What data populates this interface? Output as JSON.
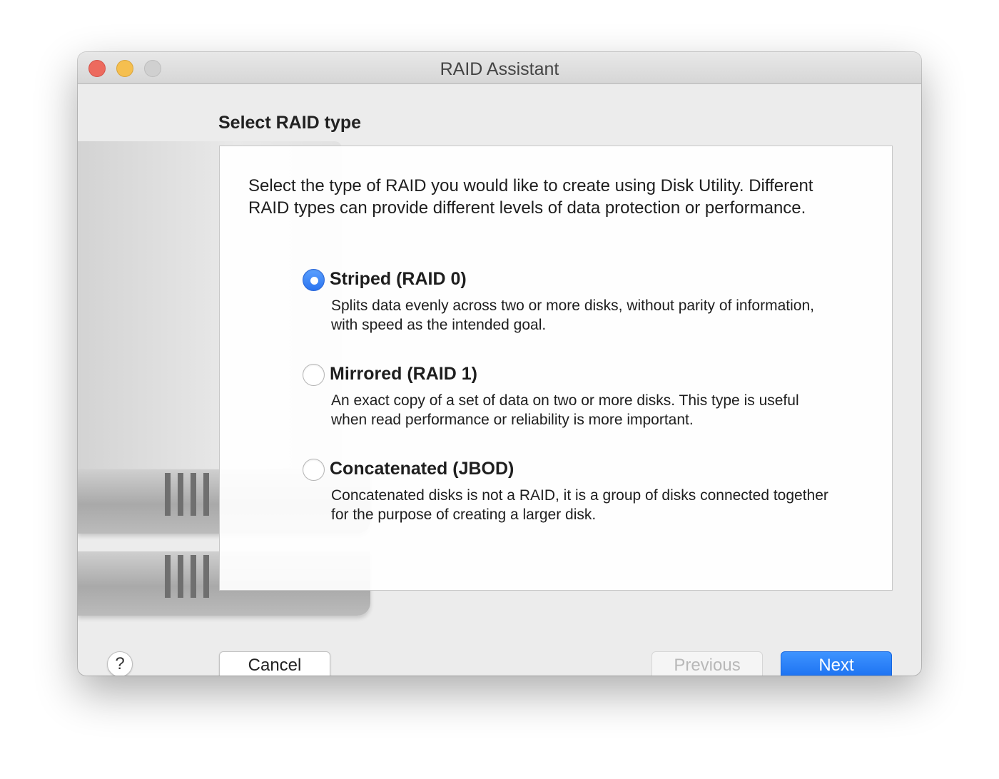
{
  "window": {
    "title": "RAID Assistant"
  },
  "page": {
    "heading": "Select RAID type",
    "intro": "Select the type of RAID you would like to create using Disk Utility. Different RAID types can provide different levels of data protection or performance."
  },
  "options": [
    {
      "label": "Striped (RAID 0)",
      "description": "Splits data evenly across two or more disks, without parity of information, with speed as the intended goal.",
      "selected": true
    },
    {
      "label": "Mirrored (RAID 1)",
      "description": "An exact copy of a set of data on two or more disks. This type is useful when read performance or reliability is more important.",
      "selected": false
    },
    {
      "label": "Concatenated (JBOD)",
      "description": "Concatenated disks is not a RAID, it is a group of disks connected together for the purpose of creating a larger disk.",
      "selected": false
    }
  ],
  "footer": {
    "help_label": "?",
    "cancel_label": "Cancel",
    "previous_label": "Previous",
    "previous_enabled": false,
    "next_label": "Next"
  },
  "icons": {
    "close": "close-dot",
    "minimize": "minimize-dot",
    "zoom": "zoom-dot",
    "artwork": "hard-drive-stack"
  },
  "colors": {
    "accent": "#2b74f0",
    "close": "#ed6a5e",
    "minimize": "#f5bf4f",
    "zoom_disabled": "#d0d0d0"
  }
}
